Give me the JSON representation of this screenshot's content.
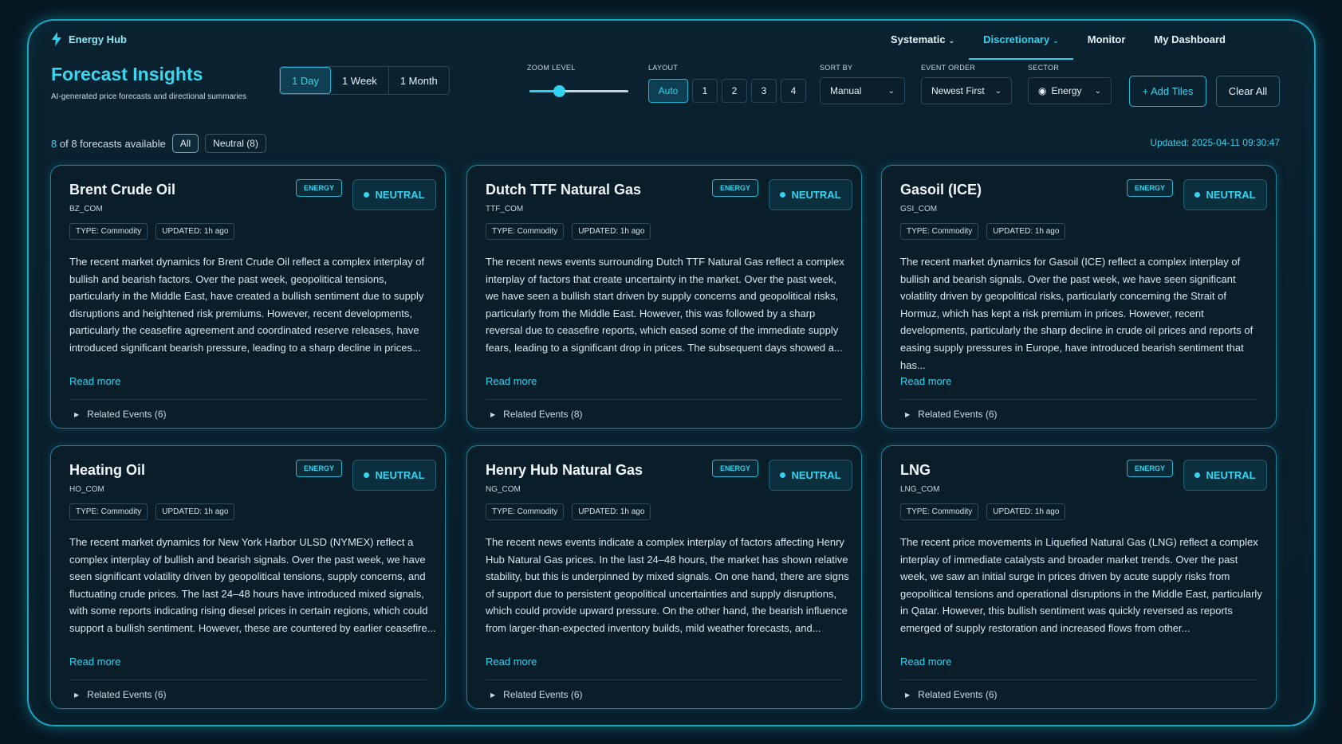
{
  "brand": {
    "name": "Energy Hub"
  },
  "nav": [
    {
      "label": "Systematic",
      "dropdown": true,
      "active": false
    },
    {
      "label": "Discretionary",
      "dropdown": true,
      "active": true
    },
    {
      "label": "Monitor",
      "dropdown": false,
      "active": false
    },
    {
      "label": "My Dashboard",
      "dropdown": false,
      "active": false
    }
  ],
  "header": {
    "title": "Forecast Insights",
    "subtitle": "AI-generated price forecasts and directional summaries"
  },
  "timeframe": {
    "options": [
      "1 Day",
      "1 Week",
      "1 Month"
    ],
    "selected": "1 Day"
  },
  "controls": {
    "zoom_label": "ZOOM LEVEL",
    "zoom_level": 0.3,
    "layout_label": "LAYOUT",
    "layout_options": [
      "Auto",
      "1",
      "2",
      "3",
      "4"
    ],
    "layout_selected": "Auto",
    "sort_label": "SORT BY",
    "sort_value": "Manual",
    "event_order_label": "EVENT ORDER",
    "event_order_value": "Newest First",
    "sector_label": "SECTOR",
    "sector_value": "Energy",
    "add_tiles": "+ Add Tiles",
    "clear_all": "Clear All"
  },
  "summary": {
    "count": "8",
    "count_text": "of 8 forecasts available",
    "filters": [
      "All",
      "Neutral (8)"
    ],
    "updated": "Updated: 2025-04-11 09:30:47"
  },
  "colors": {
    "accent": "#2fd2ef",
    "background": "#061722",
    "border": "#1aa6c0"
  },
  "cards": [
    {
      "name": "Brent Crude Oil",
      "code": "BZ_COM",
      "sector": "ENERGY",
      "signal": "NEUTRAL",
      "type": "TYPE: Commodity",
      "updated": "UPDATED: 1h ago",
      "body": "The recent market dynamics for Brent Crude Oil reflect a complex interplay of bullish and bearish factors. Over the past week, geopolitical tensions, particularly in the Middle East, have created a bullish sentiment due to supply disruptions and heightened risk premiums. However, recent developments, particularly the ceasefire agreement and coordinated reserve releases, have introduced significant bearish pressure, leading to a sharp decline in prices...",
      "read_more": "Read more",
      "related": "Related Events (6)"
    },
    {
      "name": "Dutch TTF Natural Gas",
      "code": "TTF_COM",
      "sector": "ENERGY",
      "signal": "NEUTRAL",
      "type": "TYPE: Commodity",
      "updated": "UPDATED: 1h ago",
      "body": "The recent news events surrounding Dutch TTF Natural Gas reflect a complex interplay of factors that create uncertainty in the market. Over the past week, we have seen a bullish start driven by supply concerns and geopolitical risks, particularly from the Middle East. However, this was followed by a sharp reversal due to ceasefire reports, which eased some of the immediate supply fears, leading to a significant drop in prices. The subsequent days showed a...",
      "read_more": "Read more",
      "related": "Related Events (8)"
    },
    {
      "name": "Gasoil (ICE)",
      "code": "GSI_COM",
      "sector": "ENERGY",
      "signal": "NEUTRAL",
      "type": "TYPE: Commodity",
      "updated": "UPDATED: 1h ago",
      "body": "The recent market dynamics for Gasoil (ICE) reflect a complex interplay of bullish and bearish signals. Over the past week, we have seen significant volatility driven by geopolitical risks, particularly concerning the Strait of Hormuz, which has kept a risk premium in prices. However, recent developments, particularly the sharp decline in crude oil prices and reports of easing supply pressures in Europe, have introduced bearish sentiment that has...",
      "read_more": "Read more",
      "related": "Related Events (6)"
    },
    {
      "name": "Heating Oil",
      "code": "HO_COM",
      "sector": "ENERGY",
      "signal": "NEUTRAL",
      "type": "TYPE: Commodity",
      "updated": "UPDATED: 1h ago",
      "body": "The recent market dynamics for New York Harbor ULSD (NYMEX) reflect a complex interplay of bullish and bearish signals. Over the past week, we have seen significant volatility driven by geopolitical tensions, supply concerns, and fluctuating crude prices. The last 24–48 hours have introduced mixed signals, with some reports indicating rising diesel prices in certain regions, which could support a bullish sentiment. However, these are countered by earlier ceasefire...",
      "read_more": "Read more",
      "related": "Related Events (6)"
    },
    {
      "name": "Henry Hub Natural Gas",
      "code": "NG_COM",
      "sector": "ENERGY",
      "signal": "NEUTRAL",
      "type": "TYPE: Commodity",
      "updated": "UPDATED: 1h ago",
      "body": "The recent news events indicate a complex interplay of factors affecting Henry Hub Natural Gas prices. In the last 24–48 hours, the market has shown relative stability, but this is underpinned by mixed signals. On one hand, there are signs of support due to persistent geopolitical uncertainties and supply disruptions, which could provide upward pressure. On the other hand, the bearish influence from larger-than-expected inventory builds, mild weather forecasts, and...",
      "read_more": "Read more",
      "related": "Related Events (6)"
    },
    {
      "name": "LNG",
      "code": "LNG_COM",
      "sector": "ENERGY",
      "signal": "NEUTRAL",
      "type": "TYPE: Commodity",
      "updated": "UPDATED: 1h ago",
      "body": "The recent price movements in Liquefied Natural Gas (LNG) reflect a complex interplay of immediate catalysts and broader market trends. Over the past week, we saw an initial surge in prices driven by acute supply risks from geopolitical tensions and operational disruptions in the Middle East, particularly in Qatar. However, this bullish sentiment was quickly reversed as reports emerged of supply restoration and increased flows from other...",
      "read_more": "Read more",
      "related": "Related Events (6)"
    }
  ]
}
